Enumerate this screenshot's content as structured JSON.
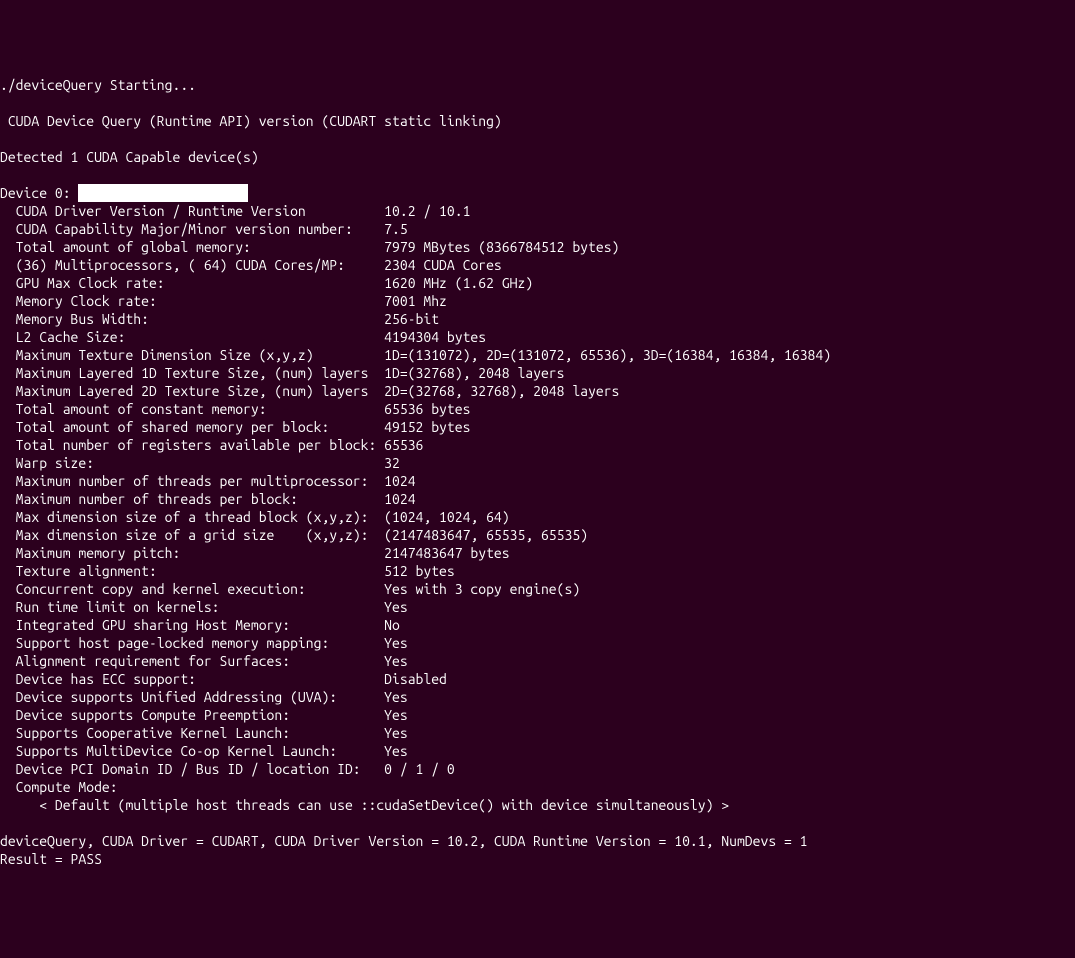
{
  "header": {
    "starting": "./deviceQuery Starting...",
    "runtime_api": " CUDA Device Query (Runtime API) version (CUDART static linking)",
    "detected": "Detected 1 CUDA Capable device(s)",
    "device_prefix": "Device 0: "
  },
  "props": [
    {
      "label": "  CUDA Driver Version / Runtime Version",
      "value": "10.2 / 10.1"
    },
    {
      "label": "  CUDA Capability Major/Minor version number:",
      "value": "7.5"
    },
    {
      "label": "  Total amount of global memory:",
      "value": "7979 MBytes (8366784512 bytes)"
    },
    {
      "label": "  (36) Multiprocessors, ( 64) CUDA Cores/MP:",
      "value": "2304 CUDA Cores"
    },
    {
      "label": "  GPU Max Clock rate:",
      "value": "1620 MHz (1.62 GHz)"
    },
    {
      "label": "  Memory Clock rate:",
      "value": "7001 Mhz"
    },
    {
      "label": "  Memory Bus Width:",
      "value": "256-bit"
    },
    {
      "label": "  L2 Cache Size:",
      "value": "4194304 bytes"
    },
    {
      "label": "  Maximum Texture Dimension Size (x,y,z)",
      "value": "1D=(131072), 2D=(131072, 65536), 3D=(16384, 16384, 16384)"
    },
    {
      "label": "  Maximum Layered 1D Texture Size, (num) layers",
      "value": "1D=(32768), 2048 layers"
    },
    {
      "label": "  Maximum Layered 2D Texture Size, (num) layers",
      "value": "2D=(32768, 32768), 2048 layers"
    },
    {
      "label": "  Total amount of constant memory:",
      "value": "65536 bytes"
    },
    {
      "label": "  Total amount of shared memory per block:",
      "value": "49152 bytes"
    },
    {
      "label": "  Total number of registers available per block:",
      "value": "65536"
    },
    {
      "label": "  Warp size:",
      "value": "32"
    },
    {
      "label": "  Maximum number of threads per multiprocessor:",
      "value": "1024"
    },
    {
      "label": "  Maximum number of threads per block:",
      "value": "1024"
    },
    {
      "label": "  Max dimension size of a thread block (x,y,z):",
      "value": "(1024, 1024, 64)"
    },
    {
      "label": "  Max dimension size of a grid size    (x,y,z):",
      "value": "(2147483647, 65535, 65535)"
    },
    {
      "label": "  Maximum memory pitch:",
      "value": "2147483647 bytes"
    },
    {
      "label": "  Texture alignment:",
      "value": "512 bytes"
    },
    {
      "label": "  Concurrent copy and kernel execution:",
      "value": "Yes with 3 copy engine(s)"
    },
    {
      "label": "  Run time limit on kernels:",
      "value": "Yes"
    },
    {
      "label": "  Integrated GPU sharing Host Memory:",
      "value": "No"
    },
    {
      "label": "  Support host page-locked memory mapping:",
      "value": "Yes"
    },
    {
      "label": "  Alignment requirement for Surfaces:",
      "value": "Yes"
    },
    {
      "label": "  Device has ECC support:",
      "value": "Disabled"
    },
    {
      "label": "  Device supports Unified Addressing (UVA):",
      "value": "Yes"
    },
    {
      "label": "  Device supports Compute Preemption:",
      "value": "Yes"
    },
    {
      "label": "  Supports Cooperative Kernel Launch:",
      "value": "Yes"
    },
    {
      "label": "  Supports MultiDevice Co-op Kernel Launch:",
      "value": "Yes"
    },
    {
      "label": "  Device PCI Domain ID / Bus ID / location ID:",
      "value": "0 / 1 / 0"
    }
  ],
  "tail": {
    "compute_mode_label": "  Compute Mode:",
    "compute_mode_text": "     < Default (multiple host threads can use ::cudaSetDevice() with device simultaneously) >",
    "summary": "deviceQuery, CUDA Driver = CUDART, CUDA Driver Version = 10.2, CUDA Runtime Version = 10.1, NumDevs = 1",
    "result": "Result = PASS"
  },
  "layout": {
    "label_width_chars": 49
  }
}
